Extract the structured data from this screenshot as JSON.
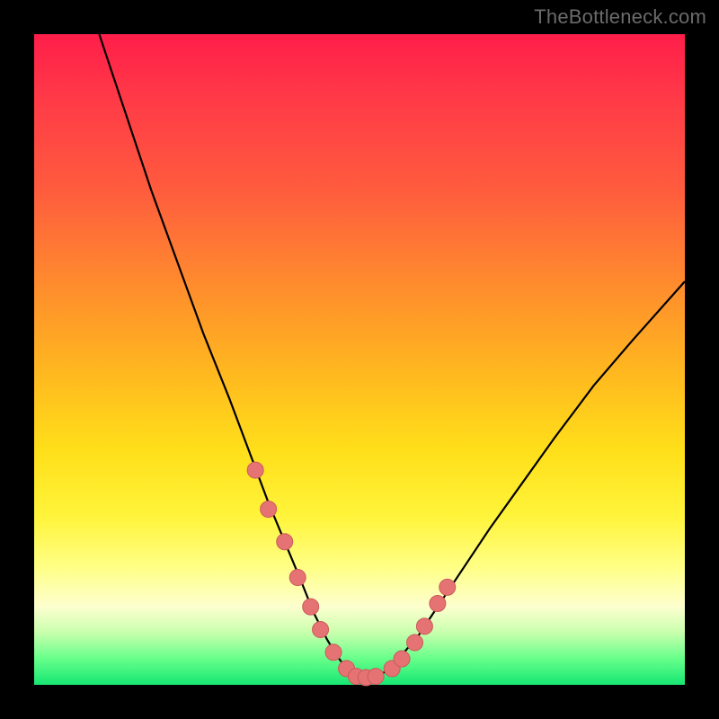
{
  "watermark": "TheBottleneck.com",
  "colors": {
    "frame": "#000000",
    "curve": "#000000",
    "marker_fill": "#e57373",
    "marker_stroke": "#cc5a5a"
  },
  "chart_data": {
    "type": "line",
    "title": "",
    "xlabel": "",
    "ylabel": "",
    "xlim": [
      0,
      100
    ],
    "ylim": [
      0,
      100
    ],
    "grid": false,
    "legend": false,
    "series": [
      {
        "name": "bottleneck-curve",
        "x": [
          10,
          14,
          18,
          22,
          26,
          30,
          33,
          36,
          38.5,
          41,
          43,
          45,
          46.5,
          48,
          49,
          50,
          52,
          54,
          56,
          59,
          62,
          66,
          70,
          75,
          80,
          86,
          92,
          100
        ],
        "values": [
          100,
          88,
          76,
          65,
          54,
          44,
          36,
          28,
          22,
          16,
          11,
          7,
          4.5,
          2.5,
          1.5,
          1,
          1.2,
          2,
          4,
          7.5,
          12,
          18,
          24,
          31,
          38,
          46,
          53,
          62
        ]
      }
    ],
    "markers": {
      "name": "highlighted-points",
      "x": [
        34,
        36,
        38.5,
        40.5,
        42.5,
        44,
        46,
        48,
        49.5,
        51,
        52.5,
        55,
        56.5,
        58.5,
        60,
        62,
        63.5
      ],
      "values": [
        33,
        27,
        22,
        16.5,
        12,
        8.5,
        5,
        2.5,
        1.3,
        1.1,
        1.3,
        2.5,
        4,
        6.5,
        9,
        12.5,
        15
      ]
    }
  }
}
